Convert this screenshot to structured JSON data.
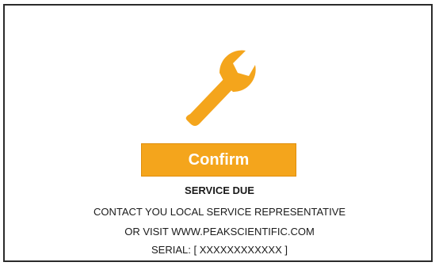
{
  "dialog": {
    "icon": "wrench-icon",
    "accent_color": "#f4a51c",
    "confirm_label": "Confirm",
    "title": "SERVICE DUE",
    "line1": "CONTACT YOU LOCAL SERVICE REPRESENTATIVE",
    "line2": "OR VISIT WWW.PEAKSCIENTIFIC.COM",
    "serial": "SERIAL: [ XXXXXXXXXXXX ]"
  }
}
